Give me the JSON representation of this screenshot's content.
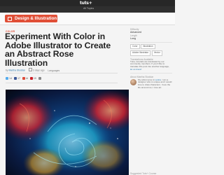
{
  "header": {
    "logo": "tuts+",
    "category_all": "All Topics",
    "brand_label": "Design & Illustration"
  },
  "article": {
    "kicker": "COLOR",
    "title": "Experiment With Color in Adobe Illustrator to Create an Abstract Rose Illustration",
    "byline": {
      "prefix": "by",
      "author": "Martha Stoddar",
      "date": "3 days ago",
      "languages": "Languages"
    },
    "shares": [
      {
        "icon": "twitter-icon",
        "count": "14"
      },
      {
        "icon": "facebook-icon",
        "count": "17"
      },
      {
        "icon": "google-plus-icon",
        "count": "ld"
      },
      {
        "icon": "pinterest-icon",
        "count": "19"
      },
      {
        "icon": "email-icon",
        "count": ""
      }
    ],
    "hero_alt": "abstract rose illustration"
  },
  "sidebar": {
    "difficulty_label": "Difficulty",
    "difficulty": "Advanced",
    "length_label": "Length",
    "length": "Long",
    "tags": [
      "Color",
      "Illustration",
      "Adobe Illustrator",
      "Vector"
    ],
    "translations_label": "Translations Available",
    "translations_text": "Tuts+ tutorials are translated by our community members. If you'd like to translate this post into another language,",
    "translations_link": "let us know!",
    "about_label": "About Martha Stoddar",
    "about_text": "My artist name is",
    "about_name": "Lanira",
    "about_text_rest": ". I am a designer who is unique and I would love to draw characters. I love the life around me; I love art.",
    "suggested_label": "Suggested Tuts+ Course"
  },
  "colors": {
    "accent": "#e04e36",
    "dark": "#272727",
    "link": "#2a7ab0"
  }
}
